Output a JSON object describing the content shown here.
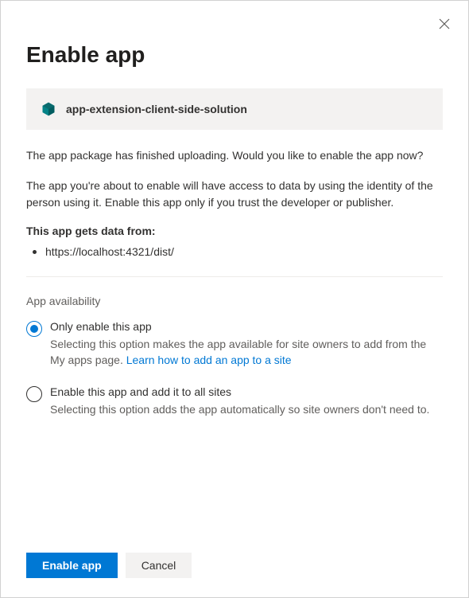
{
  "dialog": {
    "title": "Enable app",
    "app_name": "app-extension-client-side-solution",
    "uploaded_text": "The app package has finished uploading. Would you like to enable the app now?",
    "trust_text": "The app you're about to enable will have access to data by using the identity of the person using it. Enable this app only if you trust the developer or publisher.",
    "data_from_label": "This app gets data from:",
    "data_sources": [
      "https://localhost:4321/dist/"
    ],
    "availability": {
      "heading": "App availability",
      "options": [
        {
          "label": "Only enable this app",
          "desc_prefix": "Selecting this option makes the app available for site owners to add from the My apps page. ",
          "link_text": "Learn how to add an app to a site",
          "selected": true
        },
        {
          "label": "Enable this app and add it to all sites",
          "desc": "Selecting this option adds the app automatically so site owners don't need to.",
          "selected": false
        }
      ]
    },
    "buttons": {
      "primary": "Enable app",
      "secondary": "Cancel"
    }
  }
}
